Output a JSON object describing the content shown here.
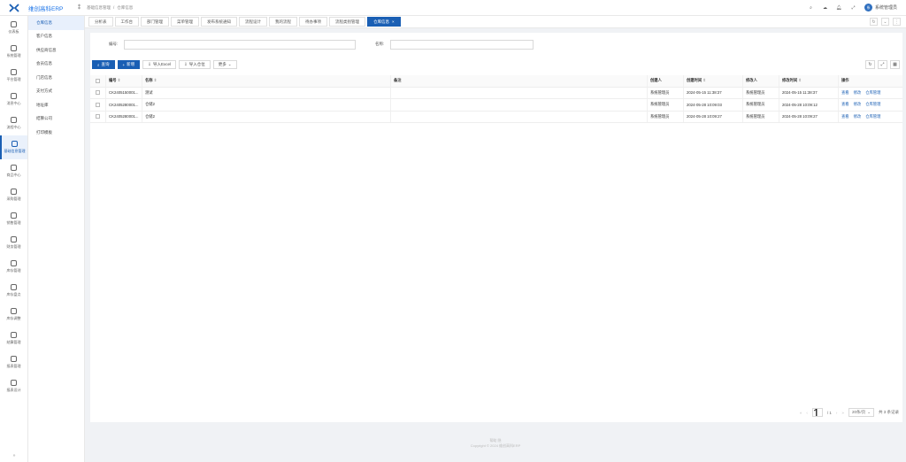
{
  "app": {
    "title": "维创高科ERP"
  },
  "breadcrumb": [
    "基础信息管理",
    "/",
    "仓库信息"
  ],
  "user": {
    "avatar_text": "系",
    "name": "系统管理员"
  },
  "rail": [
    {
      "label": "仪表板"
    },
    {
      "label": "系统管理"
    },
    {
      "label": "平台管理"
    },
    {
      "label": "消息中心"
    },
    {
      "label": "流程中心"
    },
    {
      "label": "基础信息管理"
    },
    {
      "label": "商品中心"
    },
    {
      "label": "采购管理"
    },
    {
      "label": "销售管理"
    },
    {
      "label": "财务管理"
    },
    {
      "label": "库存管理"
    },
    {
      "label": "库存盘点"
    },
    {
      "label": "库存调整"
    },
    {
      "label": "结算管理"
    },
    {
      "label": "报表管理"
    },
    {
      "label": "报表设计"
    }
  ],
  "submenu": [
    "仓库信息",
    "客户信息",
    "供应商信息",
    "会员信息",
    "门店信息",
    "支付方式",
    "地址库",
    "结算公司",
    "打印模板"
  ],
  "tabs": [
    "分析表",
    "工作台",
    "部门管理",
    "菜单管理",
    "发布系统通知",
    "流程设计",
    "我的流程",
    "待办事项",
    "流程类别管理",
    "仓库信息"
  ],
  "search": {
    "code_label": "编号:",
    "name_label": "名称:"
  },
  "toolbar": {
    "query": "查询",
    "add": "新增",
    "import_excel": "导入Excel",
    "import_position": "导入仓位",
    "more": "更多"
  },
  "table": {
    "headers": [
      "编号",
      "名称",
      "备注",
      "创建人",
      "创建时间",
      "修改人",
      "修改时间",
      "操作"
    ],
    "rows": [
      {
        "code": "CK2405150001...",
        "name": "测试",
        "note": "",
        "creator": "系统管理员",
        "ctime": "2024-05-15 11:38:37",
        "modifier": "系统管理员",
        "mtime": "2024-05-15 11:38:37"
      },
      {
        "code": "CK2405280001...",
        "name": "仓储2",
        "note": "",
        "creator": "系统管理员",
        "ctime": "2024-05-28 10:09:03",
        "modifier": "系统管理员",
        "mtime": "2024-05-28 10:09:12"
      },
      {
        "code": "CK2405280001...",
        "name": "仓储2",
        "note": "",
        "creator": "系统管理员",
        "ctime": "2024-05-28 10:09:27",
        "modifier": "系统管理员",
        "mtime": "2024-05-28 10:09:27"
      }
    ],
    "ops": [
      "查看",
      "修改",
      "仓库管理"
    ]
  },
  "pager": {
    "page": "1",
    "total_pages": "/ 1",
    "page_size": "20条/页",
    "total": "共 3 条记录"
  },
  "footer": {
    "links": "帮助    隐",
    "copyright": "Copyright © 2024 维创高科ERP"
  },
  "colors": {
    "primary": "#1a5fb4",
    "link": "#1a5fb4"
  }
}
